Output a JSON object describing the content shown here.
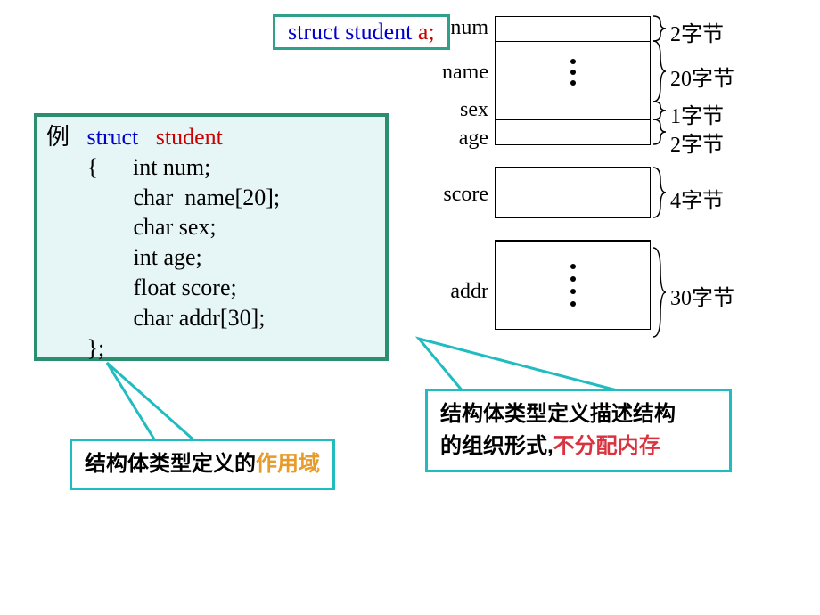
{
  "decl": {
    "struct": "struct",
    "student": "student ",
    "a_semi": "a;"
  },
  "code": {
    "li": "例",
    "struct": "struct",
    "student": "student",
    "brace_open": "{",
    "l1": "int num;",
    "l2": "char  name[20];",
    "l3": "char sex;",
    "l4": "int age;",
    "l5": "float score;",
    "l6": "char addr[30];",
    "brace_close": "};"
  },
  "mem_labels": {
    "num": "num",
    "name": "name",
    "sex": "sex",
    "age": "age",
    "score": "score",
    "addr": "addr"
  },
  "mem_sizes": {
    "num": "2字节",
    "name": "20字节",
    "sex": "1字节",
    "age": "2字节",
    "score": "4字节",
    "addr": "30字节"
  },
  "callout1": {
    "t1": "结构体类型定义的",
    "t2": "作用域"
  },
  "callout2": {
    "l1a": "结构体类型定义描述结构",
    "l2a": "的组织形式,",
    "l2b": "不分配内存"
  }
}
